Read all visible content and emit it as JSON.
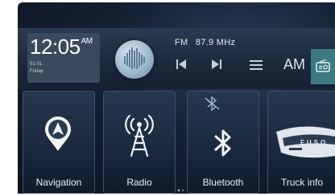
{
  "clock": {
    "time": "12:05",
    "ampm": "AM",
    "date_line1": "01-01",
    "date_line2": "Friday"
  },
  "now_playing": {
    "band": "FM",
    "frequency": "87.9 MHz"
  },
  "controls": {
    "prev_icon": "skip-previous-icon",
    "next_icon": "skip-next-icon",
    "menu_icon": "menu-icon",
    "am_label": "AM",
    "radio_icon": "radio-icon"
  },
  "tiles": [
    {
      "label": "Navigation",
      "icon": "navigation-pin-icon"
    },
    {
      "label": "Radio",
      "icon": "radio-tower-icon"
    },
    {
      "label": "Bluetooth",
      "icon": "bluetooth-icon"
    },
    {
      "label": "Truck info",
      "icon": "truck-icon"
    }
  ],
  "truck_badge": "FUSO",
  "colors": {
    "accent_teal": "#3c7a80",
    "background_navy": "#142033"
  }
}
